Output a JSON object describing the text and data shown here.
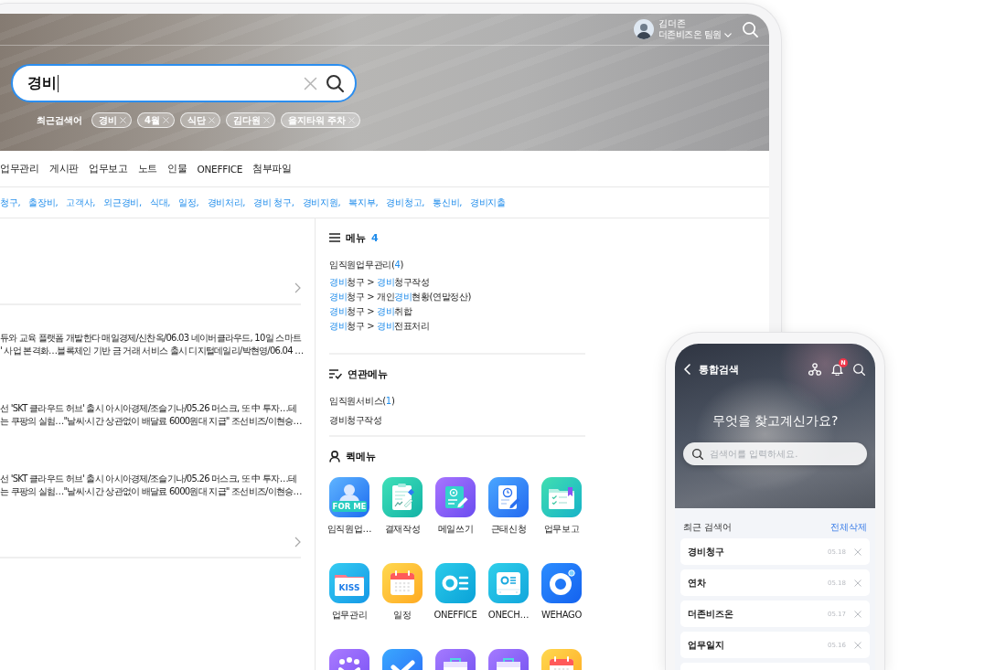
{
  "banner": {
    "user": {
      "name": "김더존",
      "role": "더존비즈온 팀원"
    },
    "search": {
      "value": "경비"
    },
    "recent_label": "최근검색어",
    "recent_searches": [
      "경비",
      "4월",
      "식단",
      "김다원",
      "을지타워 주차"
    ]
  },
  "categories": [
    "업무관리",
    "게시판",
    "업무보고",
    "노트",
    "인물",
    "ONEFFICE",
    "첨부파일"
  ],
  "related_keywords": [
    "청구,",
    "출장비,",
    "고객사,",
    "외근경비,",
    "식대,",
    "일정,",
    "경비처리,",
    "경비 청구,",
    "경비지원,",
    "복지부,",
    "경비청고,",
    "통신비,",
    "경비지출"
  ],
  "news": [
    {
      "lines": [
        "듀와 교육 플랫폼 개발한다 매일경제/신찬옥/06.03 네이버클라우드, 10일 스마트",
        "' 사업 본격화…블록체인 기반 금 거래 서비스 출시 디지털데일리/박현영/06.04 …"
      ]
    },
    {
      "lines": [
        "선 'SKT 클라우드 허브' 출시 아시아경제/조슬기나/05.26 머스크, 또 中 투자…테",
        "는 쿠팡의 실험…\"날씨·시간 상관없이 배달료 6000원대 지급\" 조선비즈/이현승…"
      ]
    },
    {
      "lines": [
        "선 'SKT 클라우드 허브' 출시 아시아경제/조슬기나/05.26 머스크, 또 中 투자…테",
        "는 쿠팡의 실험…\"날씨·시간 상관없이 배달료 6000원대 지급\" 조선비즈/이현승…"
      ]
    }
  ],
  "menu": {
    "title": "메뉴",
    "count": "4",
    "groups": [
      {
        "title": [
          {
            "text": "임직원업무관리(",
            "highlight": false
          },
          {
            "text": "4",
            "highlight": true
          },
          {
            "text": ")",
            "highlight": false
          }
        ],
        "items": [
          [
            {
              "text": "경비",
              "highlight": true
            },
            {
              "text": "청구 > ",
              "highlight": false
            },
            {
              "text": "경비",
              "highlight": true
            },
            {
              "text": "청구작성",
              "highlight": false
            }
          ],
          [
            {
              "text": "경비",
              "highlight": true
            },
            {
              "text": "청구 > 개인",
              "highlight": false
            },
            {
              "text": "경비",
              "highlight": true
            },
            {
              "text": "현황(연말정산)",
              "highlight": false
            }
          ],
          [
            {
              "text": "경비",
              "highlight": true
            },
            {
              "text": "청구 > ",
              "highlight": false
            },
            {
              "text": "경비",
              "highlight": true
            },
            {
              "text": "취합",
              "highlight": false
            }
          ],
          [
            {
              "text": "경비",
              "highlight": true
            },
            {
              "text": "청구 > ",
              "highlight": false
            },
            {
              "text": "경비",
              "highlight": true
            },
            {
              "text": "전표처리",
              "highlight": false
            }
          ]
        ]
      }
    ]
  },
  "related_menu": {
    "title": "연관메뉴",
    "groups": [
      {
        "title": [
          {
            "text": "임직원서비스(",
            "highlight": false
          },
          {
            "text": "1",
            "highlight": true
          },
          {
            "text": ")",
            "highlight": false
          }
        ],
        "items": [
          [
            {
              "text": "경비청구작성",
              "highlight": false
            }
          ]
        ]
      }
    ]
  },
  "quick_menu": {
    "title": "퀵메뉴",
    "items": [
      {
        "label": "임직원업…",
        "kind": "forme",
        "caption": "FOR ME"
      },
      {
        "label": "결재작성",
        "kind": "approval"
      },
      {
        "label": "메일쓰기",
        "kind": "mail"
      },
      {
        "label": "근태신청",
        "kind": "attendance"
      },
      {
        "label": "업무보고",
        "kind": "report"
      },
      {
        "label": "업무관리",
        "kind": "kiss",
        "caption": "KISS"
      },
      {
        "label": "일정",
        "kind": "calendar"
      },
      {
        "label": "ONEFFICE",
        "kind": "oneffice"
      },
      {
        "label": "ONECH…",
        "kind": "onechamber"
      },
      {
        "label": "WEHAGO",
        "kind": "wehago"
      },
      {
        "kind": "group"
      },
      {
        "kind": "check"
      },
      {
        "kind": "bag"
      },
      {
        "kind": "bag"
      },
      {
        "kind": "calendar"
      }
    ]
  },
  "phone": {
    "title": "통합검색",
    "badge": "N",
    "heading": "무엇을 찾고계신가요?",
    "search": {
      "placeholder": "검색어를 입력하세요."
    },
    "recent_label": "최근 검색어",
    "clear_all": "전체삭제",
    "history": [
      {
        "term": "경비청구",
        "date": "05.18"
      },
      {
        "term": "연차",
        "date": "05.18"
      },
      {
        "term": "더존비즈온",
        "date": "05.17"
      },
      {
        "term": "업무일지",
        "date": "05.16"
      }
    ]
  }
}
